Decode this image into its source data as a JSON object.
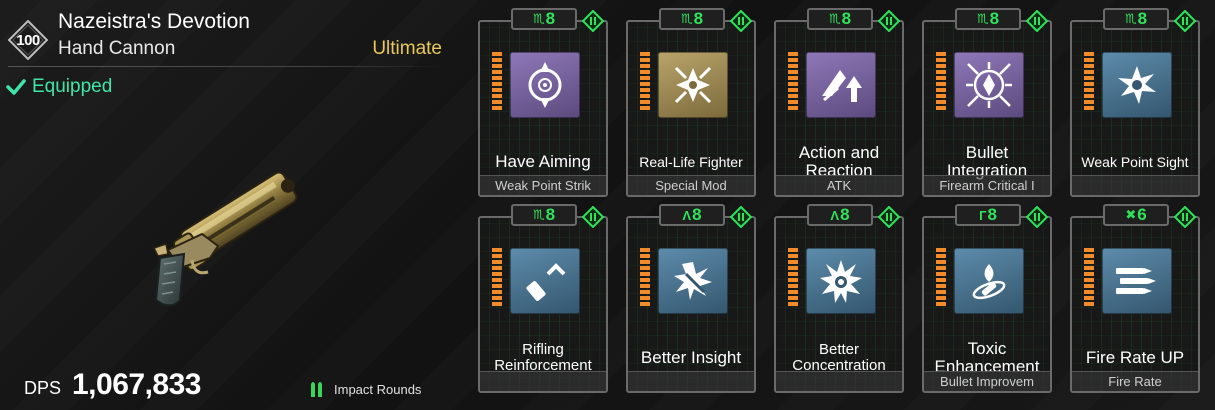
{
  "weapon": {
    "level": "100",
    "name": "Nazeistra's Devotion",
    "type": "Hand Cannon",
    "rarity": "Ultimate",
    "equipped_label": "Equipped",
    "dps_label": "DPS",
    "dps_value": "1,067,833",
    "ammo_type": "Impact Rounds"
  },
  "colors": {
    "equipped": "#3ee6a8",
    "rarity": "#e8c85a",
    "capacity": "#2fe35a",
    "accent_bars": "#f28c2a"
  },
  "mods": [
    {
      "name": "Have Aiming",
      "category": "Weak Point Strik",
      "cost": "8",
      "cost_symbol": "m",
      "icon": "aim-target-icon",
      "tier": "purple"
    },
    {
      "name": "Real-Life Fighter",
      "category": "Special Mod",
      "cost": "8",
      "cost_symbol": "m",
      "icon": "burst-icon",
      "tier": "gold"
    },
    {
      "name": "Action and Reaction",
      "category": "ATK",
      "cost": "8",
      "cost_symbol": "m",
      "icon": "arrows-up-icon",
      "tier": "purple"
    },
    {
      "name": "Bullet Integration",
      "category": "Firearm Critical I",
      "cost": "8",
      "cost_symbol": "m",
      "icon": "converge-icon",
      "tier": "purple"
    },
    {
      "name": "Weak Point Sight",
      "category": "",
      "cost": "8",
      "cost_symbol": "m",
      "icon": "weak-point-icon",
      "tier": "blue"
    },
    {
      "name": "Rifling Reinforcement",
      "category": "",
      "cost": "8",
      "cost_symbol": "m",
      "icon": "bullet-chevron-icon",
      "tier": "blue"
    },
    {
      "name": "Better Insight",
      "category": "",
      "cost": "8",
      "cost_symbol": "^",
      "icon": "crosshair-burst-icon",
      "tier": "blue"
    },
    {
      "name": "Better Concentration",
      "category": "",
      "cost": "8",
      "cost_symbol": "^",
      "icon": "star-burst-icon",
      "tier": "blue"
    },
    {
      "name": "Toxic Enhancement",
      "category": "Bullet Improvem",
      "cost": "8",
      "cost_symbol": "r",
      "icon": "toxic-orbit-icon",
      "tier": "blue"
    },
    {
      "name": "Fire Rate UP",
      "category": "Fire Rate",
      "cost": "6",
      "cost_symbol": "x",
      "icon": "triple-bullet-icon",
      "tier": "blue"
    }
  ]
}
